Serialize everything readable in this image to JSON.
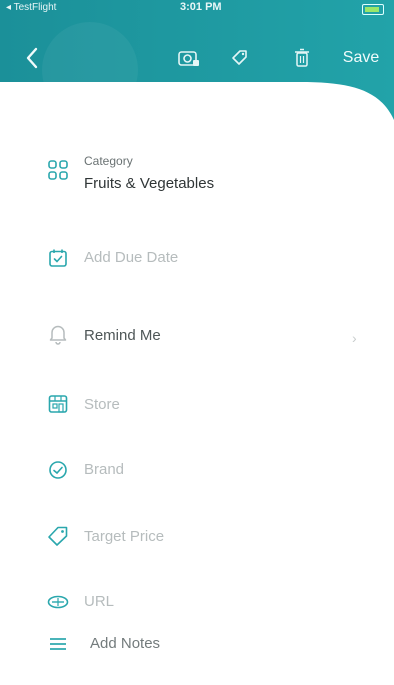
{
  "status_bar": {
    "carrier": "◂ TestFlight",
    "time": "3:01 PM"
  },
  "toolbar": {
    "back_label": "<",
    "save_label": "Save"
  },
  "category": {
    "caption": "Category",
    "value": "Fruits & Vegetables"
  },
  "fields": {
    "due_date": "Add Due Date",
    "remind_me": "Remind Me",
    "store": "Store",
    "brand": "Brand",
    "target_price": "Target Price",
    "url": "URL",
    "notes": "Add Notes"
  },
  "icons": {
    "back": "chevron-left-icon",
    "camera": "camera-icon",
    "tag": "tag-icon",
    "trash": "trash-icon",
    "category": "grid-icon",
    "due_date": "calendar-check-icon",
    "remind": "bell-icon",
    "store": "store-icon",
    "brand": "badge-check-icon",
    "price": "price-tag-icon",
    "url": "link-icon",
    "notes": "menu-lines-icon"
  },
  "colors": {
    "header_teal": "#1f9aa2",
    "icon_teal": "#2aa7ad"
  }
}
